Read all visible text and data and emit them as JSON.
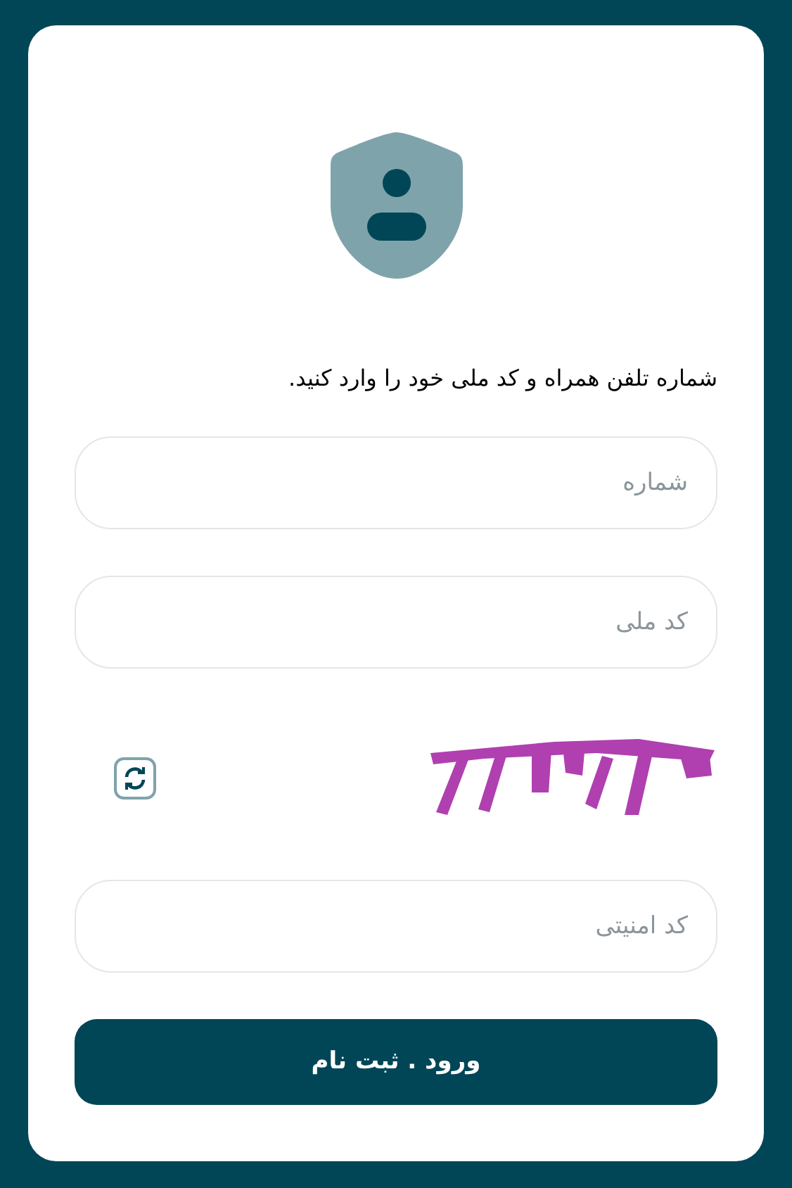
{
  "instruction": "شماره تلفن همراه و کد ملی خود را وارد کنید.",
  "fields": [
    {
      "placeholder": "شماره"
    },
    {
      "placeholder": "کد ملی"
    }
  ],
  "security_field": {
    "placeholder": "کد امنیتی"
  },
  "submit_button": "ورود . ثبت نام"
}
